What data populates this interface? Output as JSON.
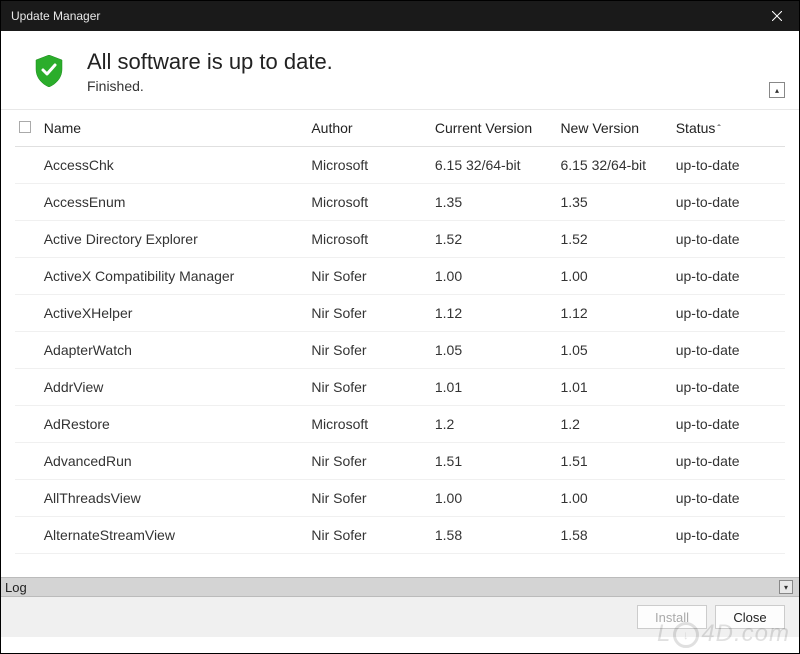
{
  "window": {
    "title": "Update Manager"
  },
  "header": {
    "heading": "All software is up to date.",
    "subheading": "Finished."
  },
  "table": {
    "columns": {
      "name": "Name",
      "author": "Author",
      "current": "Current Version",
      "new_version": "New Version",
      "status": "Status"
    },
    "sort_indicator": "ˆ",
    "rows": [
      {
        "name": "AccessChk",
        "author": "Microsoft",
        "current": "6.15 32/64-bit",
        "new_version": "6.15 32/64-bit",
        "status": "up-to-date"
      },
      {
        "name": "AccessEnum",
        "author": "Microsoft",
        "current": "1.35",
        "new_version": "1.35",
        "status": "up-to-date"
      },
      {
        "name": "Active Directory Explorer",
        "author": "Microsoft",
        "current": "1.52",
        "new_version": "1.52",
        "status": "up-to-date"
      },
      {
        "name": "ActiveX Compatibility Manager",
        "author": "Nir Sofer",
        "current": "1.00",
        "new_version": "1.00",
        "status": "up-to-date"
      },
      {
        "name": "ActiveXHelper",
        "author": "Nir Sofer",
        "current": "1.12",
        "new_version": "1.12",
        "status": "up-to-date"
      },
      {
        "name": "AdapterWatch",
        "author": "Nir Sofer",
        "current": "1.05",
        "new_version": "1.05",
        "status": "up-to-date"
      },
      {
        "name": "AddrView",
        "author": "Nir Sofer",
        "current": "1.01",
        "new_version": "1.01",
        "status": "up-to-date"
      },
      {
        "name": "AdRestore",
        "author": "Microsoft",
        "current": "1.2",
        "new_version": "1.2",
        "status": "up-to-date"
      },
      {
        "name": "AdvancedRun",
        "author": "Nir Sofer",
        "current": "1.51",
        "new_version": "1.51",
        "status": "up-to-date"
      },
      {
        "name": "AllThreadsView",
        "author": "Nir Sofer",
        "current": "1.00",
        "new_version": "1.00",
        "status": "up-to-date"
      },
      {
        "name": "AlternateStreamView",
        "author": "Nir Sofer",
        "current": "1.58",
        "new_version": "1.58",
        "status": "up-to-date"
      }
    ]
  },
  "log": {
    "label": "Log"
  },
  "footer": {
    "install": "Install",
    "close": "Close"
  },
  "watermark": {
    "prefix": "L",
    "circle": "↓",
    "suffix": "4D.com"
  }
}
